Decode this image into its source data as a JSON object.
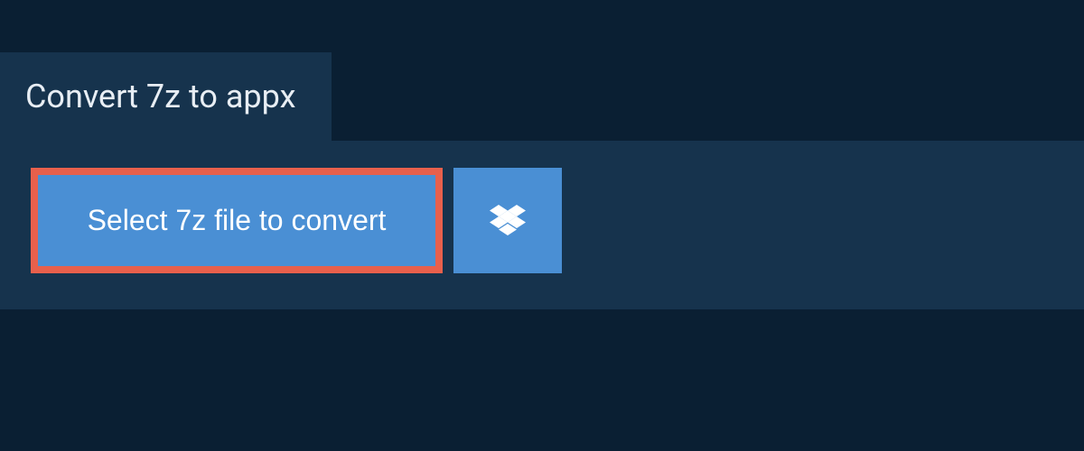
{
  "header": {
    "title": "Convert 7z to appx"
  },
  "actions": {
    "select_file_label": "Select 7z file to convert"
  },
  "colors": {
    "background": "#0a1f33",
    "panel": "#16334d",
    "button": "#4a8fd4",
    "highlight_border": "#e8604c",
    "text_light": "#e8eef4",
    "text_white": "#ffffff"
  }
}
